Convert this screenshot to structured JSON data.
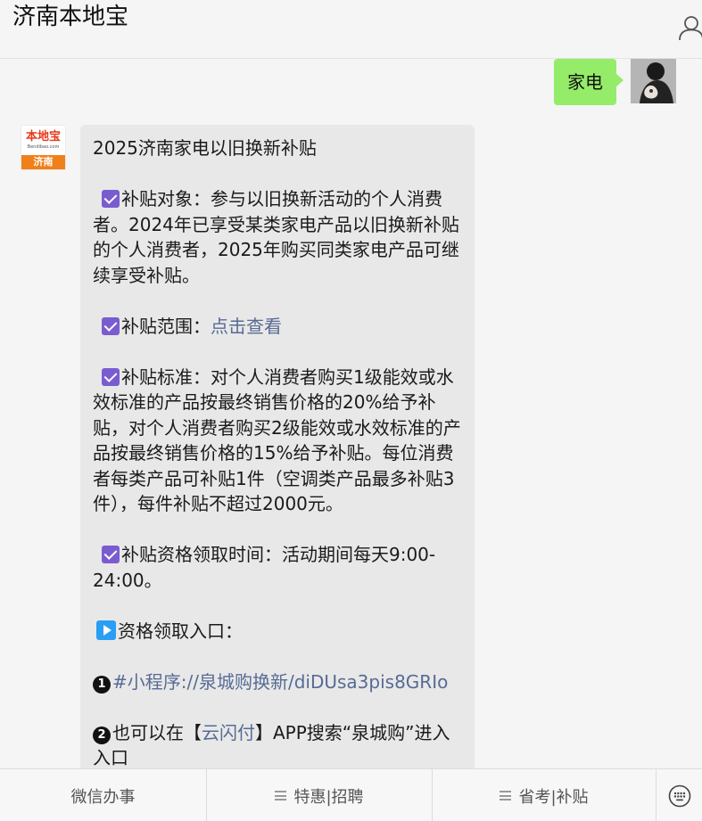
{
  "header": {
    "title": "济南本地宝",
    "user_icon": "person-icon"
  },
  "user_message": {
    "text": "家电"
  },
  "bot_avatar": {
    "brand": "本地宝",
    "site": "Bendibao.com",
    "city": "济南"
  },
  "bot_message": {
    "title": "2025济南家电以旧换新补贴",
    "target": "补贴对象：参与以旧换新活动的个人消费者。2024年已享受某类家电产品以旧换新补贴的个人消费者，2025年购买同类家电产品可继续享受补贴。",
    "scope_label": "补贴范围：",
    "scope_link": "点击查看",
    "standard": "补贴标准：对个人消费者购买1级能效或水效标准的产品按最终销售价格的20%给予补贴，对个人消费者购买2级能效或水效标准的产品按最终销售价格的15%给予补贴。每位消费者每类产品可补贴1件（空调类产品最多补贴3件），每件补贴不超过2000元。",
    "time": "补贴资格领取时间：活动期间每天9:00-24:00。",
    "entry_title": "资格领取入口：",
    "entry1_num": "1",
    "entry1_link": "#小程序://泉城购换新/diDUsa3pis8GRIo",
    "entry2_num": "2",
    "entry2_pre": "也可以在【",
    "entry2_link": "云闪付",
    "entry2_post": "】APP搜索“泉城购”进入入口"
  },
  "bottom_menu": {
    "tab1": "微信办事",
    "tab2": "特惠|招聘",
    "tab3": "省考|补贴",
    "keyboard_icon": "keyboard-icon"
  },
  "colors": {
    "user_bubble": "#95ec69",
    "link": "#576b95",
    "check": "#7a5cd0",
    "play": "#2a9df4"
  }
}
